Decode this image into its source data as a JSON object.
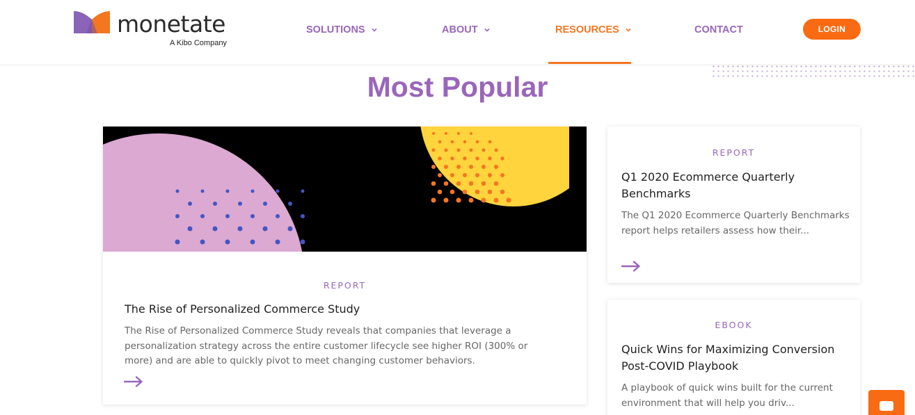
{
  "brand": {
    "name": "monetate",
    "tagline": "A Kibo Company",
    "colors": {
      "purple": "#9966bb",
      "orange": "#f47621"
    }
  },
  "nav": {
    "items": [
      {
        "label": "SOLUTIONS",
        "has_dropdown": true,
        "active": false
      },
      {
        "label": "ABOUT",
        "has_dropdown": true,
        "active": false
      },
      {
        "label": "RESOURCES",
        "has_dropdown": true,
        "active": true
      },
      {
        "label": "CONTACT",
        "has_dropdown": false,
        "active": false
      }
    ],
    "login_label": "LOGIN"
  },
  "section": {
    "title": "Most Popular"
  },
  "cards": [
    {
      "type": "REPORT",
      "title": "The Rise of Personalized Commerce Study",
      "description": "The Rise of Personalized Commerce Study reveals that companies that leverage a personalization strategy across the entire customer lifecycle see higher ROI (300% or more) and are able to quickly pivot to meet changing customer behaviors.",
      "icon": "arrow-right-icon"
    },
    {
      "type": "REPORT",
      "title": "Q1 2020 Ecommerce Quarterly Benchmarks",
      "description": "The Q1 2020 Ecommerce Quarterly Benchmarks report helps retailers assess how their...",
      "icon": "arrow-right-icon"
    },
    {
      "type": "EBOOK",
      "title": "Quick Wins for Maximizing Conversion Post-COVID Playbook",
      "description": "A playbook of quick wins built for the current environment that will help you driv...",
      "icon": "arrow-right-icon"
    }
  ],
  "chat": {
    "icon": "chat-icon"
  }
}
